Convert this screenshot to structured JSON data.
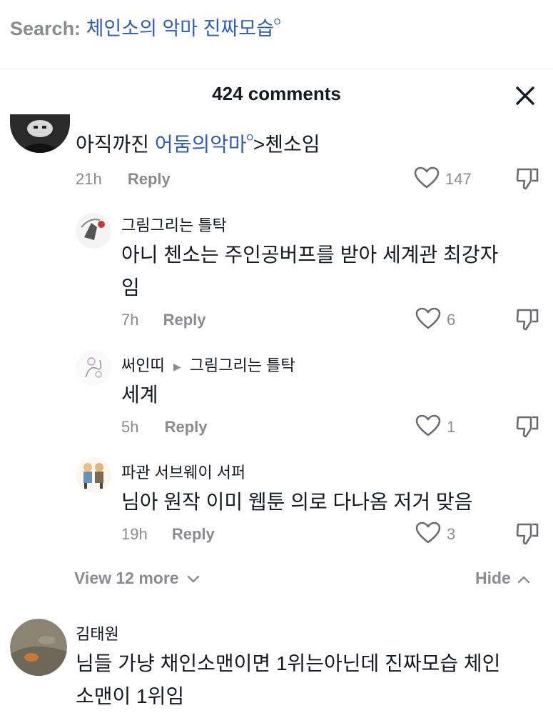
{
  "search": {
    "prefix": "Search:",
    "query": "체인소의 악마 진짜모습",
    "glyph": "ᴼ"
  },
  "comments_header": {
    "title": "424 comments"
  },
  "top_comment": {
    "text_before": "아직까진 ",
    "mention": "어둠의악마",
    "mention_glyph": "ᴼ",
    "text_after": ">첸소임",
    "time": "21h",
    "reply_label": "Reply",
    "likes": "147"
  },
  "replies": [
    {
      "username": "그림그리는 틀탁",
      "text_line1": "아니 첸소는 주인공버프를 받아 세계관 최강자",
      "text_line2": "임",
      "time": "7h",
      "reply_label": "Reply",
      "likes": "6"
    },
    {
      "username": "써인띠",
      "reply_to": "그림그리는 틀탁",
      "text_line1": "세계",
      "time": "5h",
      "reply_label": "Reply",
      "likes": "1"
    },
    {
      "username": "파관 서브웨이 서퍼",
      "text_line1": "님아 원작 이미 웹툰 의로 다나옴 저거 맞음",
      "time": "19h",
      "reply_label": "Reply",
      "likes": "3"
    }
  ],
  "thread_controls": {
    "view_more": "View 12 more",
    "hide": "Hide"
  },
  "next_comment": {
    "username": "김태원",
    "text_line1": "님들 가냥 채인소맨이면 1위는아닌데 진짜모습 체인",
    "text_line2": "소맨이 1위임"
  }
}
